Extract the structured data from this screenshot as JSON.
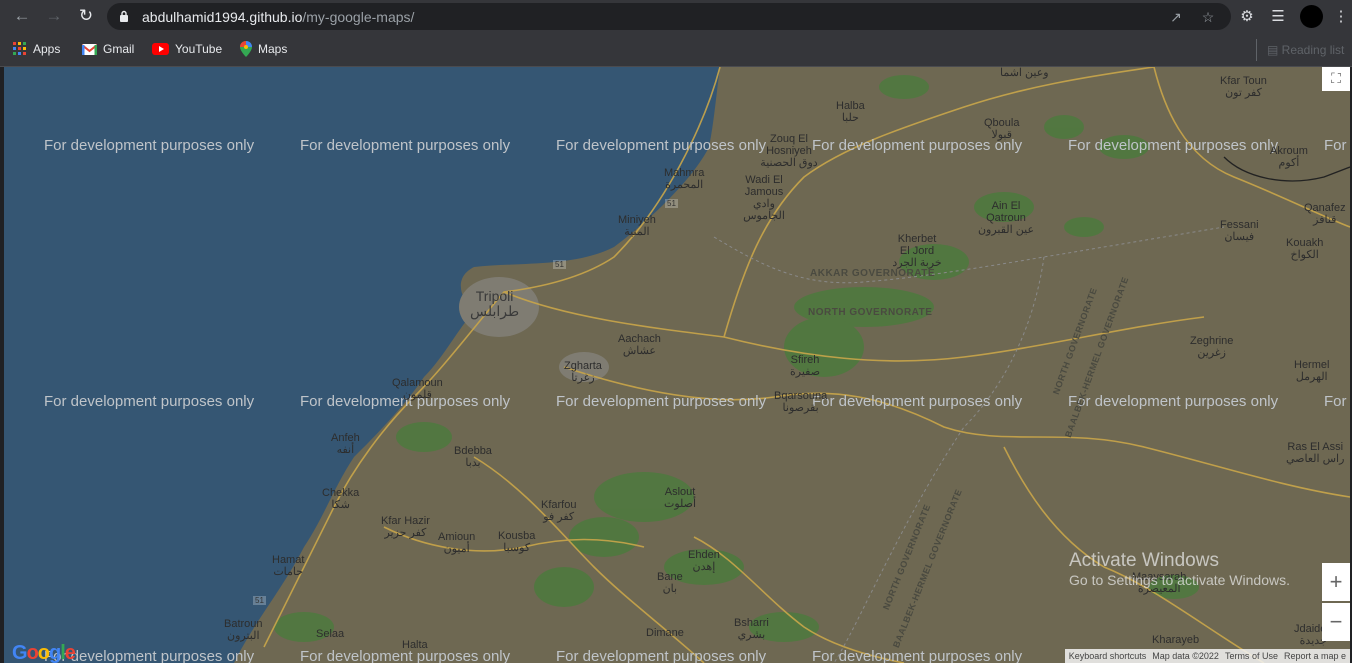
{
  "browser": {
    "url_host": "abdulhamid1994.github.io",
    "url_path": "/my-google-maps/",
    "bookmarks": [
      {
        "label": "Apps",
        "icon": "apps-grid-icon"
      },
      {
        "label": "Gmail",
        "icon": "gmail-icon"
      },
      {
        "label": "YouTube",
        "icon": "youtube-icon"
      },
      {
        "label": "Maps",
        "icon": "maps-pin-icon"
      }
    ],
    "reading_list": "Reading list"
  },
  "map": {
    "watermark": "For development purposes only",
    "places": {
      "tripoli_en": "Tripoli",
      "tripoli_ar": "طرابلس",
      "halba_en": "Halba",
      "halba_ar": "حلبا",
      "qboula_en": "Qboula",
      "qboula_ar": "قبولا",
      "kfartoun_en": "Kfar Toun",
      "kfartoun_ar": "كفر تون",
      "zouq_en": "Zouq El Hosniyeh",
      "zouq_ar": "دوق الحصنية",
      "mahmra_en": "Mahmra",
      "mahmra_ar": "المحمرة",
      "wadi_en": "Wadi El Jamous",
      "wadi_ar": "وادي الجاموس",
      "ainelqatroun_en": "Ain El Qatroun",
      "ainelqatroun_ar": "عين القبرون",
      "miniyeh_en": "Miniyeh",
      "miniyeh_ar": "المنية",
      "kherbet_en": "Kherbet El Jord",
      "kherbet_ar": "خربة الجرد",
      "fessani_en": "Fessani",
      "fessani_ar": "فيسان",
      "kouakh_en": "Kouakh",
      "kouakh_ar": "الكواخ",
      "qanafez_en": "Qanafez",
      "qanafez_ar": "قنافز",
      "akroum_en": "Akroum",
      "akroum_ar": "أكوم",
      "aachach_en": "Aachach",
      "aachach_ar": "عشاش",
      "sfireh_en": "Sfireh",
      "sfireh_ar": "صفيرة",
      "zeghrine_en": "Zeghrine",
      "zeghrine_ar": "زغرين",
      "hermel_en": "Hermel",
      "hermel_ar": "الهرمل",
      "zgharta_en": "Zgharta",
      "zgharta_ar": "زغرتا",
      "qalamoun_en": "Qalamoun",
      "qalamoun_ar": "قلمون",
      "bqarsouna_en": "Bqarsouna",
      "bqarsouna_ar": "بقرصونا",
      "anfeh_en": "Anfeh",
      "anfeh_ar": "أنفه",
      "bdebba_en": "Bdebba",
      "bdebba_ar": "بدبا",
      "rasalassi_en": "Ras El Assi",
      "rasalassi_ar": "راس العاصي",
      "chekka_en": "Chekka",
      "chekka_ar": "شكا",
      "aslout_en": "Aslout",
      "aslout_ar": "أصلوت",
      "kfarfou_en": "Kfarfou",
      "kfarfou_ar": "كفر فو",
      "kfarhazir_en": "Kfar Hazir",
      "kfarhazir_ar": "كفر حزير",
      "amioun_en": "Amioun",
      "amioun_ar": "أميون",
      "kousba_en": "Kousba",
      "kousba_ar": "كوسبا",
      "ehden_en": "Ehden",
      "ehden_ar": "إهدن",
      "hamat_en": "Hamat",
      "hamat_ar": "حامات",
      "bane_en": "Bane",
      "bane_ar": "بان",
      "maaysarah_en": "Maaysarah",
      "maaysarah_ar": "المعيصرة",
      "batroun_en": "Batroun",
      "batroun_ar": "البترون",
      "selaa_en": "Selaa",
      "halta_en": "Halta",
      "dimane_en": "Dimane",
      "bsharri_en": "Bsharri",
      "bsharri_ar": "بشري",
      "kharayeb_en": "Kharayeb",
      "jdaideh_en": "Jdaideh",
      "jdaideh_ar": "جديدة",
      "top_ar_1": "وعين اشما"
    },
    "governorates": {
      "akkar": "AKKAR GOVERNORATE",
      "north": "NORTH GOVERNORATE",
      "north_rot_1": "NORTH GOVERNORATE",
      "bh_rot_1": "BAALBEK-HERMEL GOVERNORATE",
      "north_rot_2": "NORTH GOVERNORATE",
      "bh_rot_2": "BAALBEK-HERMEL GOVERNORATE"
    },
    "routes": [
      "51",
      "51",
      "51"
    ],
    "google": "Google",
    "attribution": {
      "shortcuts": "Keyboard shortcuts",
      "mapdata": "Map data ©2022",
      "terms": "Terms of Use",
      "report": "Report a map e"
    }
  },
  "os": {
    "activate_title": "Activate Windows",
    "activate_sub": "Go to Settings to activate Windows."
  }
}
